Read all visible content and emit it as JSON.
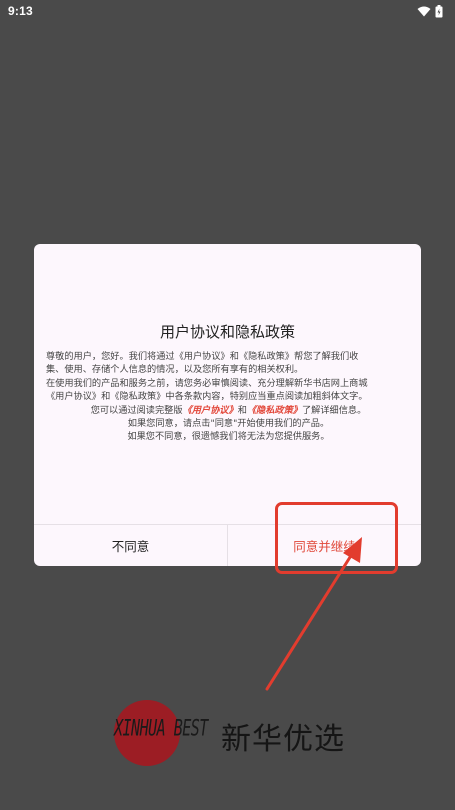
{
  "status_bar": {
    "time": "9:13",
    "icons": [
      "wifi-icon",
      "battery-icon"
    ]
  },
  "dialog": {
    "title": "用户协议和隐私政策",
    "body": {
      "p1_line1": "尊敬的用户，您好。我们将通过《用户协议》和《隐私政策》帮您了解我们收",
      "p1_line2": "集、使用、存储个人信息的情况，以及您所有享有的相关权利。",
      "p2_line1": "在使用我们的产品和服务之前，请您务必审慎阅读、充分理解新华书店网上商城",
      "p2_line2": "《用户协议》和《隐私政策》中各条款内容，特别应当重点阅读加粗斜体文字。",
      "p3_prefix": "您可以通过阅读完整版",
      "p3_link1": "《用户协议》",
      "p3_mid": "和",
      "p3_link2": "《隐私政策》",
      "p3_suffix": "了解详细信息。",
      "p4": "如果您同意，请点击\"同意\"开始使用我们的产品。",
      "p5": "如果您不同意，很遗憾我们将无法为您提供服务。"
    },
    "disagree_label": "不同意",
    "agree_label": "同意并继续"
  },
  "logo": {
    "latin": "XINHUA BEST",
    "chinese": "新华优选"
  },
  "colors": {
    "accent": "#e0483a",
    "backdrop": "#4a4a4a",
    "dialog_bg": "#fdf7fd",
    "logo_red": "#9c1d24"
  }
}
